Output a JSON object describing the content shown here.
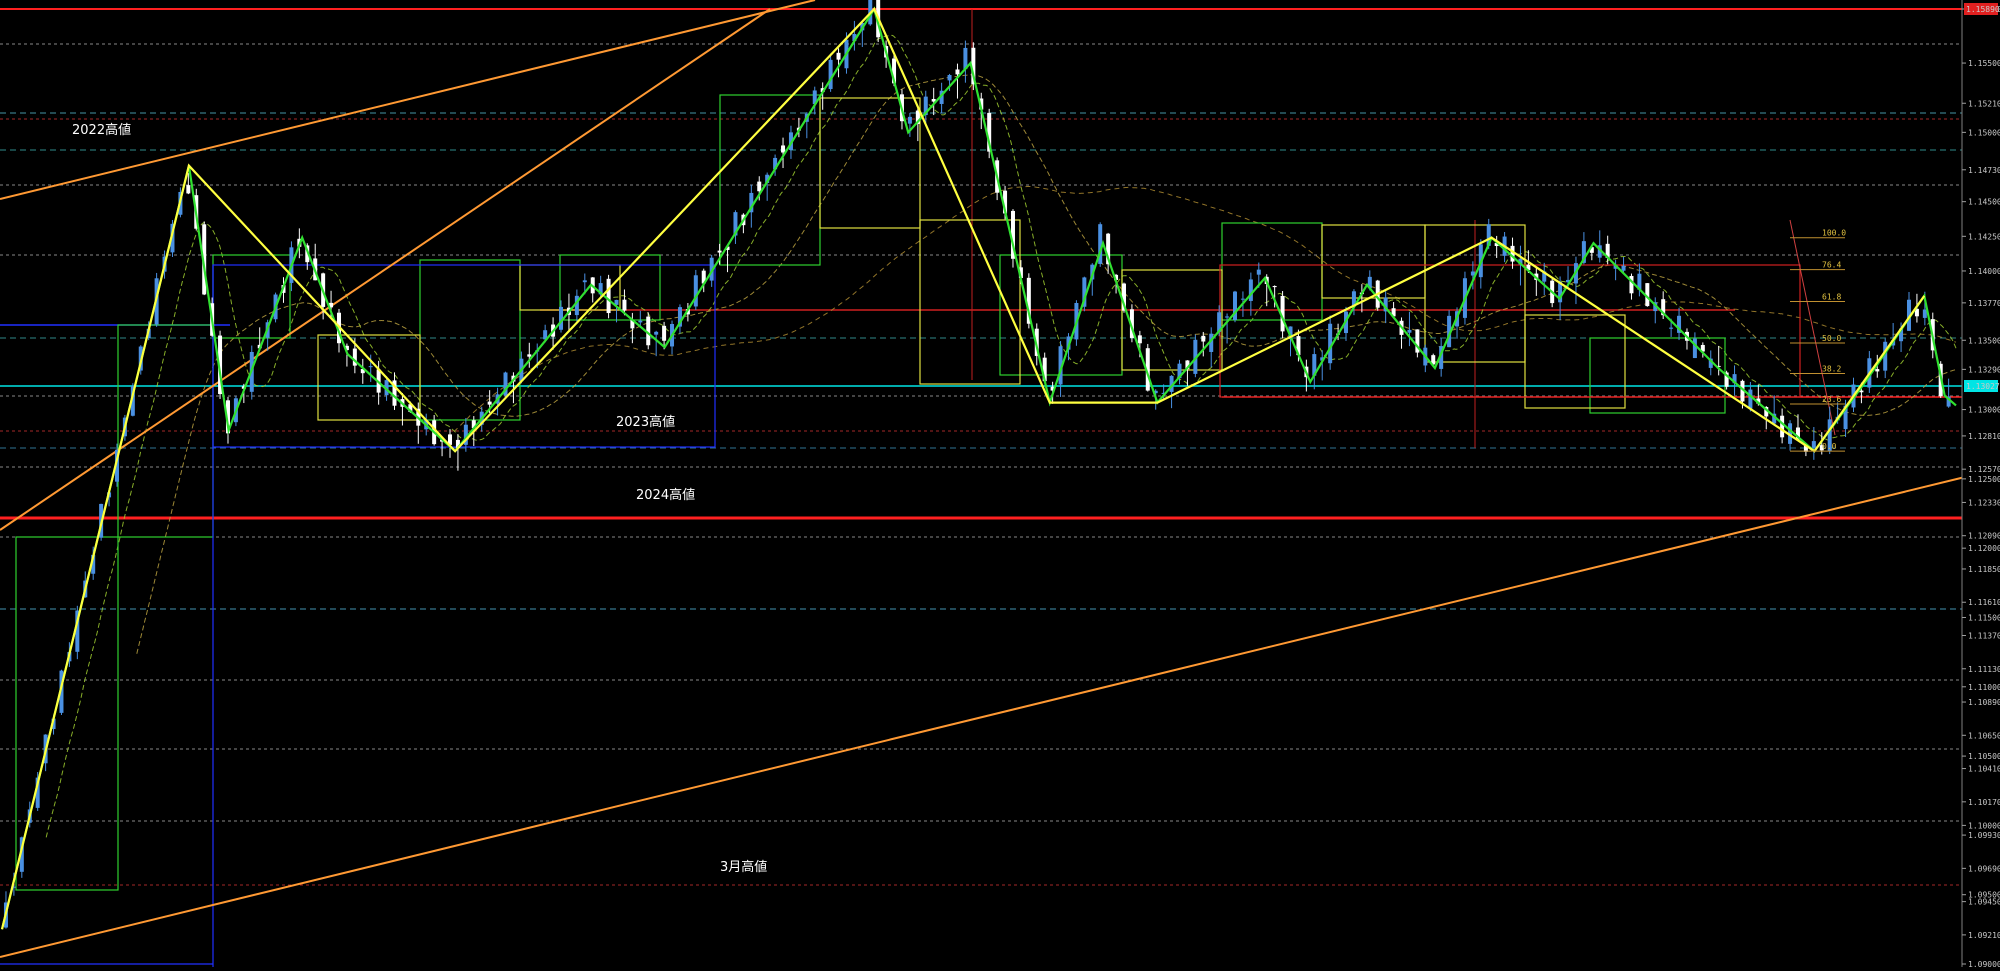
{
  "chart_data": {
    "type": "candlestick",
    "ylim": [
      1.09,
      1.1589
    ],
    "price_scale": [
      {
        "value": 1.1589,
        "label": "1.15890"
      },
      {
        "value": 1.155,
        "label": "1.15500"
      },
      {
        "value": 1.1521,
        "label": "1.15210"
      },
      {
        "value": 1.15,
        "label": "1.15000"
      },
      {
        "value": 1.1473,
        "label": "1.14730"
      },
      {
        "value": 1.145,
        "label": "1.14500"
      },
      {
        "value": 1.1425,
        "label": "1.14250"
      },
      {
        "value": 1.14,
        "label": "1.14000"
      },
      {
        "value": 1.1377,
        "label": "1.13770"
      },
      {
        "value": 1.135,
        "label": "1.13500"
      },
      {
        "value": 1.1329,
        "label": "1.13290"
      },
      {
        "value": 1.13,
        "label": "1.13000"
      },
      {
        "value": 1.1281,
        "label": "1.12810"
      },
      {
        "value": 1.1257,
        "label": "1.12570"
      },
      {
        "value": 1.125,
        "label": "1.12500"
      },
      {
        "value": 1.1233,
        "label": "1.12330"
      },
      {
        "value": 1.1209,
        "label": "1.12090"
      },
      {
        "value": 1.12,
        "label": "1.12000"
      },
      {
        "value": 1.1185,
        "label": "1.11850"
      },
      {
        "value": 1.1161,
        "label": "1.11610"
      },
      {
        "value": 1.115,
        "label": "1.11500"
      },
      {
        "value": 1.1137,
        "label": "1.11370"
      },
      {
        "value": 1.1113,
        "label": "1.11130"
      },
      {
        "value": 1.11,
        "label": "1.11000"
      },
      {
        "value": 1.1089,
        "label": "1.10890"
      },
      {
        "value": 1.1065,
        "label": "1.10650"
      },
      {
        "value": 1.105,
        "label": "1.10500"
      },
      {
        "value": 1.1041,
        "label": "1.10410"
      },
      {
        "value": 1.1017,
        "label": "1.10170"
      },
      {
        "value": 1.1,
        "label": "1.10000"
      },
      {
        "value": 1.0993,
        "label": "1.09930"
      },
      {
        "value": 1.0969,
        "label": "1.09690"
      },
      {
        "value": 1.095,
        "label": "1.09500"
      },
      {
        "value": 1.0945,
        "label": "1.09450"
      },
      {
        "value": 1.0921,
        "label": "1.09210"
      },
      {
        "value": 1.09,
        "label": "1.09000"
      }
    ],
    "annotations": [
      {
        "text": "2022高値",
        "price": 1.15,
        "bar": 75
      },
      {
        "text": "2023高値",
        "price": 1.1283,
        "bar": 615
      },
      {
        "text": "2024高値",
        "price": 1.1233,
        "bar": 636
      },
      {
        "text": "3月高値",
        "price": 1.0957,
        "bar": 725
      }
    ],
    "fibonacci": [
      {
        "label": "100.0",
        "price": 1.1424
      },
      {
        "label": "76.4",
        "price": 1.1401
      },
      {
        "label": "61.8",
        "price": 1.1378
      },
      {
        "label": "50.0",
        "price": 1.1348
      },
      {
        "label": "38.2",
        "price": 1.1326
      },
      {
        "label": "23.6",
        "price": 1.1304
      },
      {
        "label": "0.0",
        "price": 1.127
      }
    ],
    "current_price": {
      "value": 1.13027,
      "label": "1.13027"
    },
    "top_marker": {
      "value": 1.1589,
      "label": "1.15890"
    },
    "colors": {
      "background": "#000000",
      "bull_candle": "#4a90e2",
      "bear_candle": "#ffffff",
      "zigzag_major": "#ffff40",
      "zigzag_minor": "#30e030",
      "trend_line": "#ff9933",
      "resistance": "#ff2020",
      "current_price_line": "#00e5e5",
      "box_blue": "#2030ff",
      "grid": "#707070"
    },
    "swing_points": [
      {
        "bar": 0,
        "price": 1.0925
      },
      {
        "bar": 165,
        "price": 1.1476
      },
      {
        "bar": 200,
        "price": 1.1285
      },
      {
        "bar": 265,
        "price": 1.1424
      },
      {
        "bar": 305,
        "price": 1.134
      },
      {
        "bar": 400,
        "price": 1.127
      },
      {
        "bar": 520,
        "price": 1.139
      },
      {
        "bar": 585,
        "price": 1.1345
      },
      {
        "bar": 770,
        "price": 1.1589
      },
      {
        "bar": 800,
        "price": 1.15
      },
      {
        "bar": 855,
        "price": 1.155
      },
      {
        "bar": 925,
        "price": 1.1305
      },
      {
        "bar": 972,
        "price": 1.142
      },
      {
        "bar": 1020,
        "price": 1.1305
      },
      {
        "bar": 1115,
        "price": 1.1395
      },
      {
        "bar": 1155,
        "price": 1.132
      },
      {
        "bar": 1205,
        "price": 1.139
      },
      {
        "bar": 1265,
        "price": 1.133
      },
      {
        "bar": 1315,
        "price": 1.1424
      },
      {
        "bar": 1375,
        "price": 1.138
      },
      {
        "bar": 1405,
        "price": 1.142
      },
      {
        "bar": 1515,
        "price": 1.133
      },
      {
        "bar": 1600,
        "price": 1.127
      },
      {
        "bar": 1645,
        "price": 1.132
      },
      {
        "bar": 1697,
        "price": 1.1382
      },
      {
        "bar": 1715,
        "price": 1.131
      },
      {
        "bar": 1725,
        "price": 1.1303
      }
    ]
  }
}
